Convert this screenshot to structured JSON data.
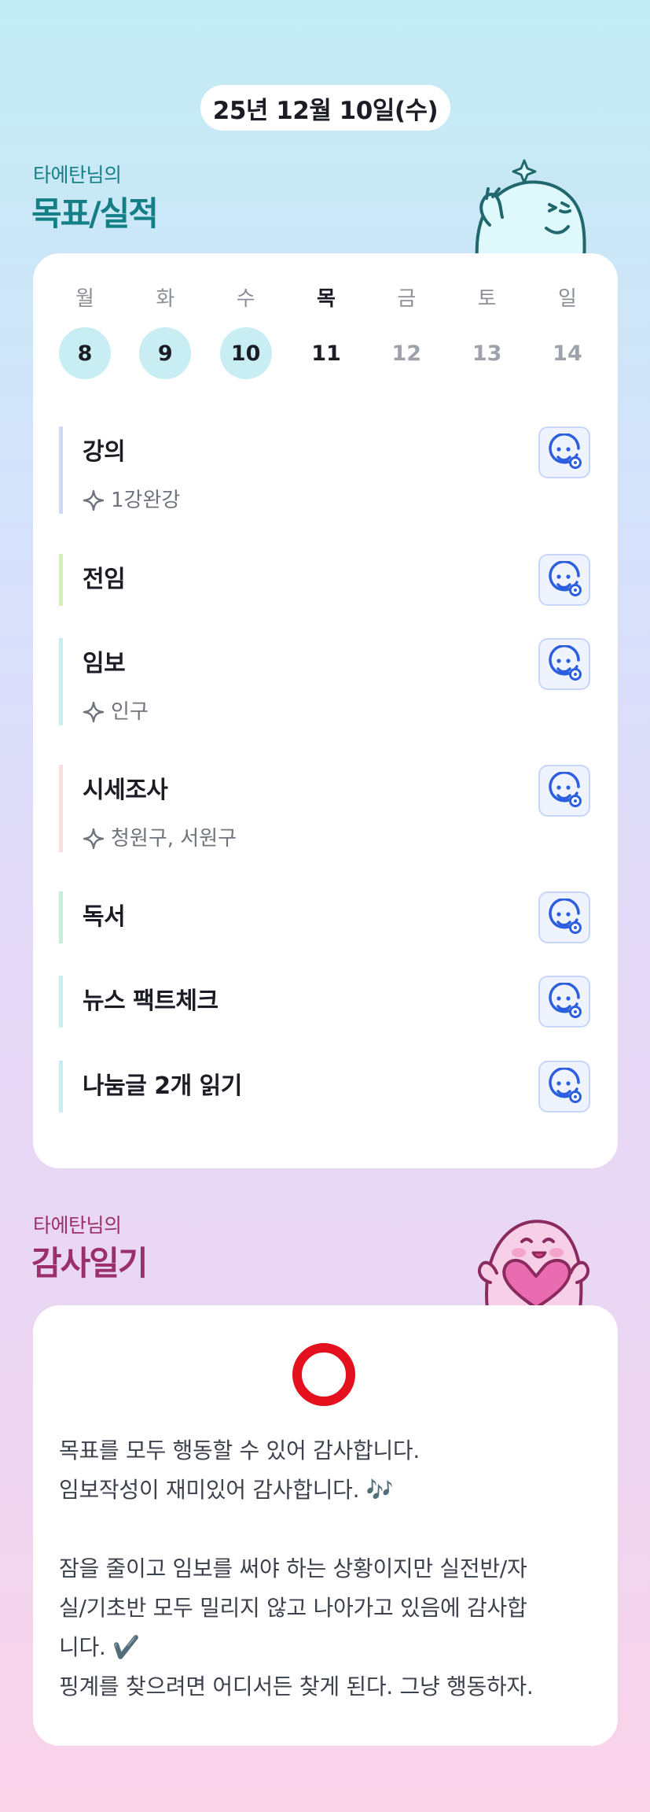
{
  "header": {
    "date": "25년 12월 10일(수)"
  },
  "goals_section": {
    "subtitle": "타에탄님의",
    "title": "목표/실적"
  },
  "week": {
    "days": [
      {
        "label": "월",
        "num": "8",
        "state": "done"
      },
      {
        "label": "화",
        "num": "9",
        "state": "done"
      },
      {
        "label": "수",
        "num": "10",
        "state": "done"
      },
      {
        "label": "목",
        "num": "11",
        "state": "today"
      },
      {
        "label": "금",
        "num": "12",
        "state": "future"
      },
      {
        "label": "토",
        "num": "13",
        "state": "future"
      },
      {
        "label": "일",
        "num": "14",
        "state": "future"
      }
    ]
  },
  "goals": [
    {
      "title": "강의",
      "sub": "1강완강",
      "color": "#cfd8f6"
    },
    {
      "title": "전임",
      "sub": "",
      "color": "#d3f0b7"
    },
    {
      "title": "임보",
      "sub": "인구",
      "color": "#c8eef4"
    },
    {
      "title": "시세조사",
      "sub": "청원구, 서원구",
      "color": "#fbdede"
    },
    {
      "title": "독서",
      "sub": "",
      "color": "#c4efd9"
    },
    {
      "title": "뉴스 팩트체크",
      "sub": "",
      "color": "#c8eef4"
    },
    {
      "title": "나눔글 2개 읽기",
      "sub": "",
      "color": "#c8eef4"
    }
  ],
  "goal_icon": "smiley-edit-icon",
  "diary_section": {
    "subtitle": "타에탄님의",
    "title": "감사일기"
  },
  "diary": {
    "mark_icon": "red-circle-icon",
    "lines": [
      "목표를 모두 행동할 수 있어 감사합니다.",
      "임보작성이 재미있어 감사합니다. 🎶"
    ],
    "para2": [
      "잠을 줄이고 임보를 써야 하는 상황이지만 실전반/자",
      "실/기초반 모두 밀리지 않고 나아가고 있음에 감사합",
      "니다. ✔️",
      "핑계를 찾으려면 어디서든 찾게 된다. 그냥 행동하자."
    ]
  },
  "colors": {
    "teal": "#157f86",
    "plum": "#9b2f6e",
    "done_day": "#c8eef4",
    "ring": "#e4101e"
  }
}
